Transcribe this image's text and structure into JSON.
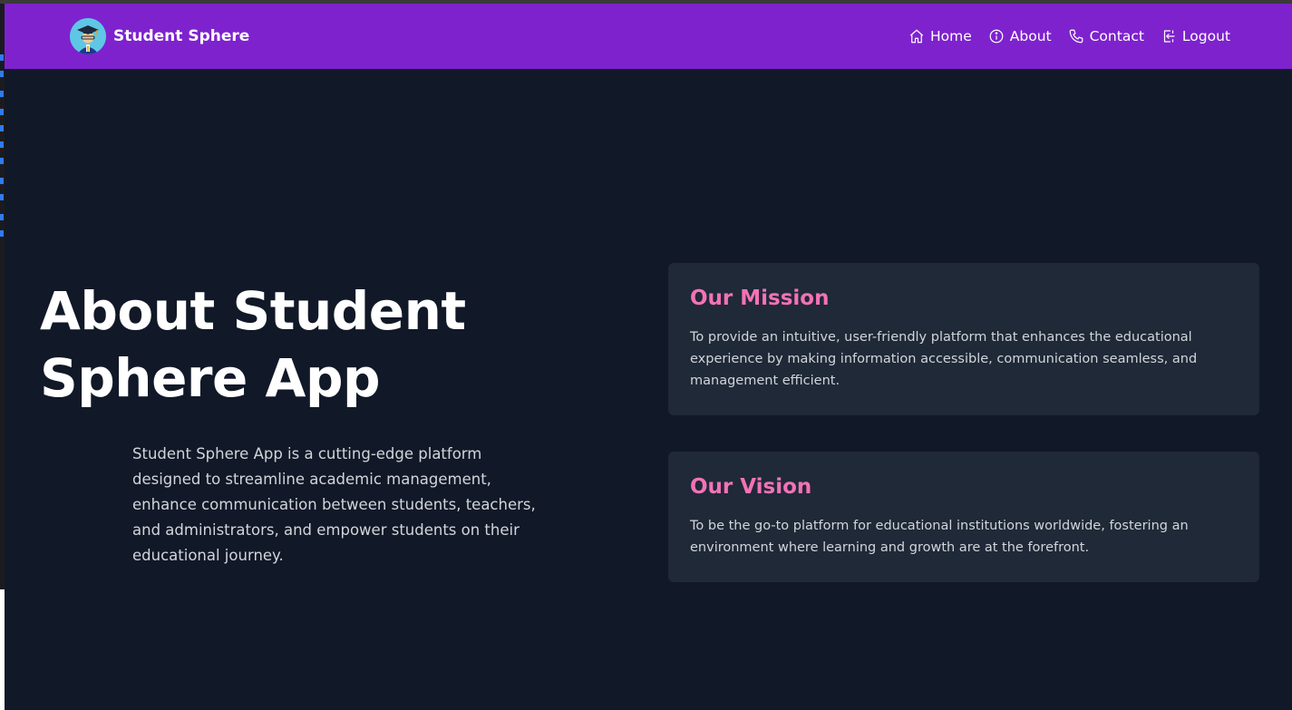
{
  "navbar": {
    "brand_name": "Student Sphere",
    "brand_color": "#7e22ce",
    "links": [
      {
        "label": "Home",
        "icon": "home-icon"
      },
      {
        "label": "About",
        "icon": "info-icon"
      },
      {
        "label": "Contact",
        "icon": "phone-icon"
      },
      {
        "label": "Logout",
        "icon": "logout-icon"
      }
    ]
  },
  "hero": {
    "title": "About Student Sphere App",
    "description": "Student Sphere App is a cutting-edge platform designed to streamline academic management, enhance communication between students, teachers, and administrators, and empower students on their educational journey."
  },
  "cards": {
    "mission": {
      "title": "Our Mission",
      "text": "To provide an intuitive, user-friendly platform that enhances the educational experience by making information accessible, communication seamless, and management efficient."
    },
    "vision": {
      "title": "Our Vision",
      "text": "To be the go-to platform for educational institutions worldwide, fostering an environment where learning and growth are at the forefront."
    },
    "heading_color": "#f472b6"
  },
  "theme": {
    "background": "#111827",
    "card_background": "#1f2937"
  }
}
